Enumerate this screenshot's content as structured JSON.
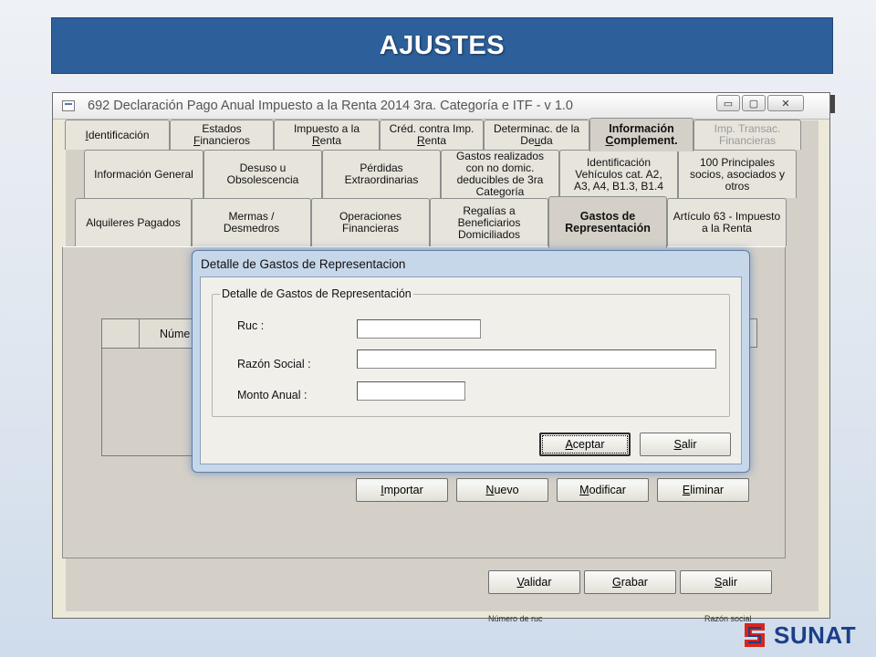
{
  "banner": {
    "title": "AJUSTES"
  },
  "window": {
    "title": "692 Declaración Pago Anual Impuesto a la Renta 2014 3ra. Categoría e ITF - v 1.0",
    "controls": {
      "minimize": "▭",
      "maximize": "▢",
      "close": "✕"
    }
  },
  "tabs_row1": [
    {
      "pre": "",
      "u": "I",
      "post": "dentificación"
    },
    {
      "l1": "Estados",
      "pre": "",
      "u": "F",
      "post": "inancieros"
    },
    {
      "l1": "Impuesto a  la",
      "pre": "",
      "u": "R",
      "post": "enta"
    },
    {
      "l1": "Créd. contra Imp.",
      "pre": "",
      "u": "R",
      "post": "enta"
    },
    {
      "l1": "Determinac. de la",
      "pre": "De",
      "u": "u",
      "post": "da"
    },
    {
      "l1": "Información",
      "pre": "",
      "u": "C",
      "post": "omplement."
    },
    {
      "l1": "Imp. Transac.",
      "l2": "Financieras"
    }
  ],
  "tabs_row2": [
    {
      "text": "Información General"
    },
    {
      "l1": "Desuso u",
      "l2": "Obsolescencia"
    },
    {
      "l1": "Pérdidas",
      "l2": "Extraordinarias"
    },
    {
      "l1": "Gastos realizados",
      "l2": "con no domic.",
      "l3": "deducibles de 3ra",
      "l4": "Categoría"
    },
    {
      "l1": "Identificación",
      "l2": "Vehículos cat. A2,",
      "l3": "A3, A4, B1.3, B1.4"
    },
    {
      "l1": "100 Principales",
      "l2": "socios, asociados y",
      "l3": "otros"
    }
  ],
  "tabs_row3": [
    {
      "text": "Alquileres Pagados"
    },
    {
      "l1": "Mermas  /",
      "l2": "Desmedros"
    },
    {
      "l1": "Operaciones",
      "l2": "Financieras"
    },
    {
      "l1": "Regalías a",
      "l2": "Beneficiarios",
      "l3": "Domiciliados"
    },
    {
      "l1": "Gastos de",
      "l2": "Representación"
    },
    {
      "l1": "Artículo 63 - Impuesto",
      "l2": "a la Renta"
    }
  ],
  "grid": {
    "header": "Núme"
  },
  "actions": [
    {
      "pre": "",
      "u": "I",
      "post": "mportar"
    },
    {
      "pre": "",
      "u": "N",
      "post": "uevo"
    },
    {
      "pre": "",
      "u": "M",
      "post": "odificar"
    },
    {
      "pre": "",
      "u": "E",
      "post": "liminar"
    }
  ],
  "footer_buttons": [
    {
      "pre": "",
      "u": "V",
      "post": "alidar"
    },
    {
      "pre": "",
      "u": "G",
      "post": "rabar"
    },
    {
      "pre": "",
      "u": "S",
      "post": "alir"
    }
  ],
  "dialog": {
    "title": "Detalle de Gastos de Representacion",
    "group": "Detalle de Gastos de Representación",
    "fields": [
      {
        "label": "Ruc :",
        "value": ""
      },
      {
        "label": "Razón Social :",
        "value": ""
      },
      {
        "label": "Monto Anual :",
        "value": ""
      }
    ],
    "ok": {
      "pre": "",
      "u": "A",
      "post": "ceptar"
    },
    "cancel": {
      "pre": "",
      "u": "S",
      "post": "alir"
    }
  },
  "background_text": [
    "Número de ruc",
    "Razón social"
  ],
  "logo": {
    "text": "SUNAT",
    "colors": {
      "red": "#d9261c",
      "blue": "#1b3e8a"
    }
  },
  "colors": {
    "banner": "#2d5f9a",
    "window_bg": "#ece9d8",
    "dialog_frame": "#c7d7ea"
  }
}
